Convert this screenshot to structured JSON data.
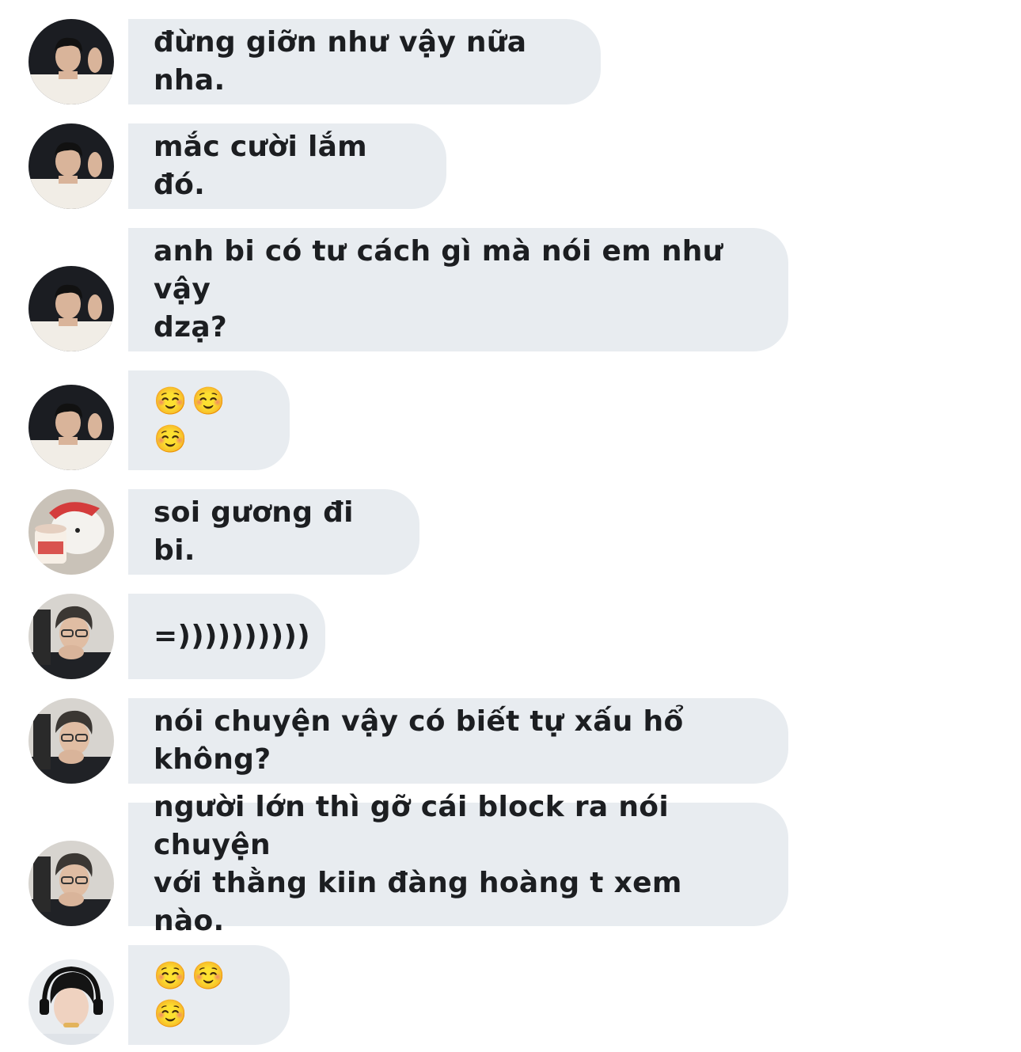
{
  "colors": {
    "bubble": "#e8ecf0",
    "text": "#1c1e21",
    "background": "#ffffff"
  },
  "messages": [
    {
      "avatar": "young-man-white-shirt-avatar",
      "text": "đừng giỡn như vậy nữa nha."
    },
    {
      "avatar": "young-man-white-shirt-avatar",
      "text": "mắc cười lắm đó."
    },
    {
      "avatar": "young-man-white-shirt-avatar",
      "text": "anh bi có tư cách gì mà nói em như vậy\ndzạ?"
    },
    {
      "avatar": "young-man-white-shirt-avatar",
      "text": "☺️☺️☺️"
    },
    {
      "avatar": "cartoon-bear-icecream-avatar",
      "text": "soi gương đi bi."
    },
    {
      "avatar": "man-glasses-phone-avatar",
      "text": "=))))))))))"
    },
    {
      "avatar": "man-glasses-phone-avatar",
      "text": "nói chuyện vậy có biết tự xấu hổ không?"
    },
    {
      "avatar": "man-glasses-phone-avatar",
      "text": "người lớn thì gỡ cái block ra nói chuyện\nvới thằng kiin đàng hoàng t xem nào."
    },
    {
      "avatar": "boy-headset-avatar",
      "text": "☺️☺️☺️"
    }
  ]
}
